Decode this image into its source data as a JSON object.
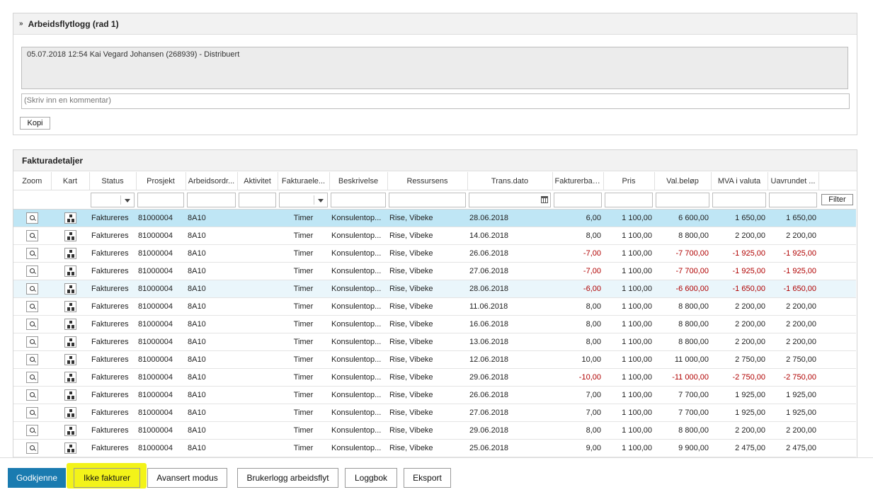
{
  "workflow_log": {
    "title": "Arbeidsflytlogg (rad 1)",
    "entry": "05.07.2018 12:54 Kai Vegard Johansen (268939) - Distribuert",
    "comment_placeholder": "(Skriv inn en kommentar)",
    "copy_label": "Kopi"
  },
  "invoice_details": {
    "title": "Fakturadetaljer",
    "columns": [
      "Zoom",
      "Kart",
      "Status",
      "Prosjekt",
      "Arbeidsordr...",
      "Aktivitet",
      "Fakturaele...",
      "Beskrivelse",
      "Ressursens",
      "Trans.dato",
      "Fakturerbar...",
      "Pris",
      "Val.beløp",
      "MVA i valuta",
      "Uavrundet ..."
    ],
    "filter_label": "Filter",
    "rows": [
      {
        "status": "Faktureres",
        "project": "81000004",
        "work_order": "8A10",
        "activity": "",
        "element": "Timer",
        "description": "Konsulentop...",
        "resource": "Rise, Vibeke",
        "date": "28.06.2018",
        "qty": "6,00",
        "price": "1 100,00",
        "amount": "6 600,00",
        "vat": "1 650,00",
        "unrounded": "1 650,00",
        "neg": false,
        "state": "selected"
      },
      {
        "status": "Faktureres",
        "project": "81000004",
        "work_order": "8A10",
        "activity": "",
        "element": "Timer",
        "description": "Konsulentop...",
        "resource": "Rise, Vibeke",
        "date": "14.06.2018",
        "qty": "8,00",
        "price": "1 100,00",
        "amount": "8 800,00",
        "vat": "2 200,00",
        "unrounded": "2 200,00",
        "neg": false,
        "state": ""
      },
      {
        "status": "Faktureres",
        "project": "81000004",
        "work_order": "8A10",
        "activity": "",
        "element": "Timer",
        "description": "Konsulentop...",
        "resource": "Rise, Vibeke",
        "date": "26.06.2018",
        "qty": "-7,00",
        "price": "1 100,00",
        "amount": "-7 700,00",
        "vat": "-1 925,00",
        "unrounded": "-1 925,00",
        "neg": true,
        "state": ""
      },
      {
        "status": "Faktureres",
        "project": "81000004",
        "work_order": "8A10",
        "activity": "",
        "element": "Timer",
        "description": "Konsulentop...",
        "resource": "Rise, Vibeke",
        "date": "27.06.2018",
        "qty": "-7,00",
        "price": "1 100,00",
        "amount": "-7 700,00",
        "vat": "-1 925,00",
        "unrounded": "-1 925,00",
        "neg": true,
        "state": ""
      },
      {
        "status": "Faktureres",
        "project": "81000004",
        "work_order": "8A10",
        "activity": "",
        "element": "Timer",
        "description": "Konsulentop...",
        "resource": "Rise, Vibeke",
        "date": "28.06.2018",
        "qty": "-6,00",
        "price": "1 100,00",
        "amount": "-6 600,00",
        "vat": "-1 650,00",
        "unrounded": "-1 650,00",
        "neg": true,
        "state": "hover"
      },
      {
        "status": "Faktureres",
        "project": "81000004",
        "work_order": "8A10",
        "activity": "",
        "element": "Timer",
        "description": "Konsulentop...",
        "resource": "Rise, Vibeke",
        "date": "11.06.2018",
        "qty": "8,00",
        "price": "1 100,00",
        "amount": "8 800,00",
        "vat": "2 200,00",
        "unrounded": "2 200,00",
        "neg": false,
        "state": ""
      },
      {
        "status": "Faktureres",
        "project": "81000004",
        "work_order": "8A10",
        "activity": "",
        "element": "Timer",
        "description": "Konsulentop...",
        "resource": "Rise, Vibeke",
        "date": "16.06.2018",
        "qty": "8,00",
        "price": "1 100,00",
        "amount": "8 800,00",
        "vat": "2 200,00",
        "unrounded": "2 200,00",
        "neg": false,
        "state": ""
      },
      {
        "status": "Faktureres",
        "project": "81000004",
        "work_order": "8A10",
        "activity": "",
        "element": "Timer",
        "description": "Konsulentop...",
        "resource": "Rise, Vibeke",
        "date": "13.06.2018",
        "qty": "8,00",
        "price": "1 100,00",
        "amount": "8 800,00",
        "vat": "2 200,00",
        "unrounded": "2 200,00",
        "neg": false,
        "state": ""
      },
      {
        "status": "Faktureres",
        "project": "81000004",
        "work_order": "8A10",
        "activity": "",
        "element": "Timer",
        "description": "Konsulentop...",
        "resource": "Rise, Vibeke",
        "date": "12.06.2018",
        "qty": "10,00",
        "price": "1 100,00",
        "amount": "11 000,00",
        "vat": "2 750,00",
        "unrounded": "2 750,00",
        "neg": false,
        "state": ""
      },
      {
        "status": "Faktureres",
        "project": "81000004",
        "work_order": "8A10",
        "activity": "",
        "element": "Timer",
        "description": "Konsulentop...",
        "resource": "Rise, Vibeke",
        "date": "29.06.2018",
        "qty": "-10,00",
        "price": "1 100,00",
        "amount": "-11 000,00",
        "vat": "-2 750,00",
        "unrounded": "-2 750,00",
        "neg": true,
        "state": ""
      },
      {
        "status": "Faktureres",
        "project": "81000004",
        "work_order": "8A10",
        "activity": "",
        "element": "Timer",
        "description": "Konsulentop...",
        "resource": "Rise, Vibeke",
        "date": "26.06.2018",
        "qty": "7,00",
        "price": "1 100,00",
        "amount": "7 700,00",
        "vat": "1 925,00",
        "unrounded": "1 925,00",
        "neg": false,
        "state": ""
      },
      {
        "status": "Faktureres",
        "project": "81000004",
        "work_order": "8A10",
        "activity": "",
        "element": "Timer",
        "description": "Konsulentop...",
        "resource": "Rise, Vibeke",
        "date": "27.06.2018",
        "qty": "7,00",
        "price": "1 100,00",
        "amount": "7 700,00",
        "vat": "1 925,00",
        "unrounded": "1 925,00",
        "neg": false,
        "state": ""
      },
      {
        "status": "Faktureres",
        "project": "81000004",
        "work_order": "8A10",
        "activity": "",
        "element": "Timer",
        "description": "Konsulentop...",
        "resource": "Rise, Vibeke",
        "date": "29.06.2018",
        "qty": "8,00",
        "price": "1 100,00",
        "amount": "8 800,00",
        "vat": "2 200,00",
        "unrounded": "2 200,00",
        "neg": false,
        "state": ""
      },
      {
        "status": "Faktureres",
        "project": "81000004",
        "work_order": "8A10",
        "activity": "",
        "element": "Timer",
        "description": "Konsulentop...",
        "resource": "Rise, Vibeke",
        "date": "25.06.2018",
        "qty": "9,00",
        "price": "1 100,00",
        "amount": "9 900,00",
        "vat": "2 475,00",
        "unrounded": "2 475,00",
        "neg": false,
        "state": ""
      }
    ]
  },
  "actions": {
    "approve": "Godkjenne",
    "do_not_invoice": "Ikke fakturer",
    "advanced_mode": "Avansert modus",
    "user_log": "Brukerlogg arbeidsflyt",
    "logbook": "Loggbok",
    "export": "Eksport"
  },
  "colors": {
    "primary_button": "#1a7bb0",
    "selected_row": "#bfe6f5",
    "negative_value": "#b00000",
    "highlight": "#f2f200"
  },
  "icons": {
    "collapse": "chevron-double-up-icon",
    "zoom": "magnifier-icon",
    "map": "tree-icon",
    "date_picker": "calendar-icon",
    "dropdown": "caret-down-icon"
  }
}
